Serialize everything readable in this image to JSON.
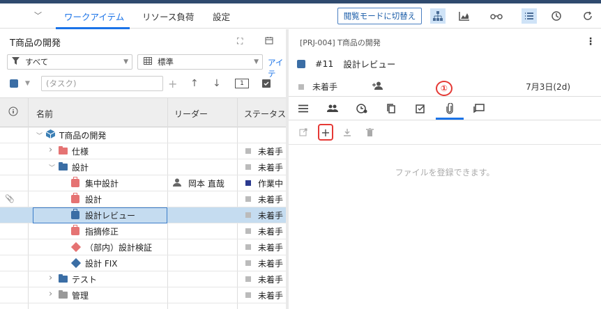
{
  "header": {
    "tabs": [
      {
        "label": "ワークアイテム",
        "active": true
      },
      {
        "label": "リソース負荷",
        "active": false
      },
      {
        "label": "設定",
        "active": false
      }
    ],
    "view_mode_button": "閲覧モードに切替え",
    "icons": [
      "hierarchy-icon",
      "chart-icon",
      "glasses-icon",
      "list-icon",
      "clock-icon",
      "refresh-icon"
    ]
  },
  "left": {
    "title": "T商品の開発",
    "filter_label": "すべて",
    "view_label": "標準",
    "link_cut": "アイテ",
    "search_placeholder": "(タスク)",
    "stepper_value": "1",
    "columns": {
      "name": "名前",
      "leader": "リーダー",
      "status": "ステータス"
    },
    "rows": [
      {
        "name": "T商品の開発",
        "icon": "project",
        "expand": "open",
        "leader": "",
        "status": "",
        "status_color": ""
      },
      {
        "name": "仕様",
        "icon": "folder-red",
        "expand": "closed",
        "leader": "",
        "status": "未着手",
        "status_color": "#bbbbbb"
      },
      {
        "name": "設計",
        "icon": "folder-blue",
        "expand": "open",
        "leader": "",
        "status": "未着手",
        "status_color": "#bbbbbb"
      },
      {
        "name": "集中設計",
        "icon": "task-red",
        "expand": "",
        "leader": "岡本 直哉",
        "status": "作業中",
        "status_color": "#2b3a8f"
      },
      {
        "name": "設計",
        "icon": "task-red",
        "expand": "",
        "leader": "",
        "status": "未着手",
        "status_color": "#bbbbbb",
        "attachment": true
      },
      {
        "name": "設計レビュー",
        "icon": "task-blue",
        "expand": "",
        "leader": "",
        "status": "未着手",
        "status_color": "#bbbbbb",
        "selected": true
      },
      {
        "name": "指摘修正",
        "icon": "task-red",
        "expand": "",
        "leader": "",
        "status": "未着手",
        "status_color": "#bbbbbb"
      },
      {
        "name": "（部内）設計検証",
        "icon": "milestone-red",
        "expand": "",
        "leader": "",
        "status": "未着手",
        "status_color": "#bbbbbb"
      },
      {
        "name": "設計 FIX",
        "icon": "milestone-blue",
        "expand": "",
        "leader": "",
        "status": "未着手",
        "status_color": "#bbbbbb"
      },
      {
        "name": "テスト",
        "icon": "folder-blue",
        "expand": "closed",
        "leader": "",
        "status": "未着手",
        "status_color": "#bbbbbb"
      },
      {
        "name": "管理",
        "icon": "folder-gray",
        "expand": "closed",
        "leader": "",
        "status": "未着手",
        "status_color": "#bbbbbb"
      }
    ]
  },
  "right": {
    "breadcrumb": "[PRJ-004] T商品の開発",
    "item_number": "#11",
    "item_title": "設計レビュー",
    "status": "未着手",
    "date": "7月3日(2d)",
    "callout": "①",
    "detail_tabs": [
      "list-icon",
      "people-icon",
      "schedule-icon",
      "copy-icon",
      "checklist-icon",
      "paperclip-icon",
      "comment-icon"
    ],
    "active_detail_tab": 5,
    "empty_message": "ファイルを登録できます。"
  }
}
